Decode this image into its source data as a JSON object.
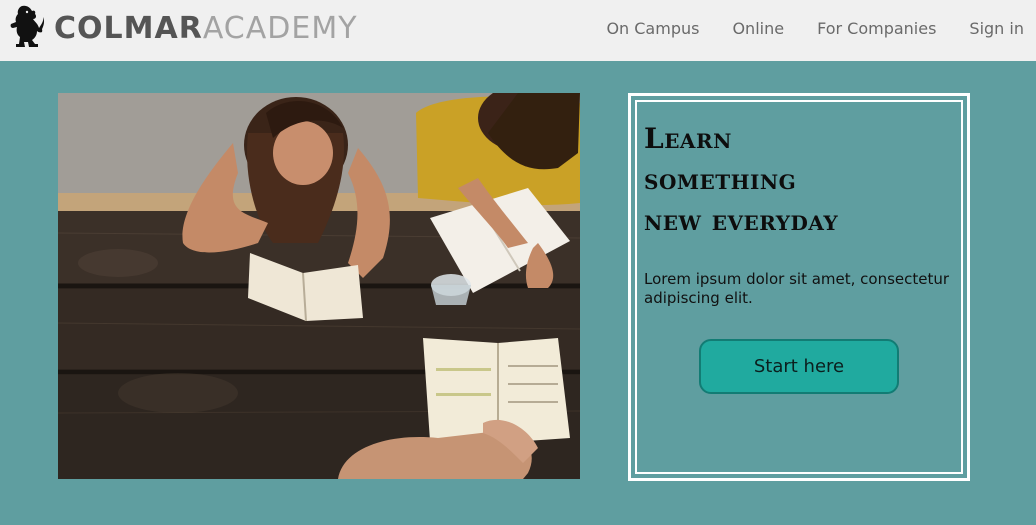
{
  "header": {
    "logo_icon": "lion-rampant-icon",
    "brand_part1": "COLMAR",
    "brand_part2": "ACADEMY",
    "nav": [
      {
        "label": "On Campus"
      },
      {
        "label": "Online"
      },
      {
        "label": "For Companies"
      },
      {
        "label": "Sign in"
      }
    ]
  },
  "hero": {
    "image": "students-reading-at-picnic-table-photo",
    "title_line1": "Learn",
    "title_line2": "something",
    "title_line3": "new everyday",
    "text": "Lorem ipsum dolor sit amet, consectetur adipiscing elit.",
    "button_label": "Start here"
  },
  "colors": {
    "page_bg": "#5f9ea0",
    "header_bg": "#f0f0f0",
    "button_bg": "#20aa9f",
    "brand_dark": "#555555",
    "brand_light": "#a3a3a3"
  }
}
